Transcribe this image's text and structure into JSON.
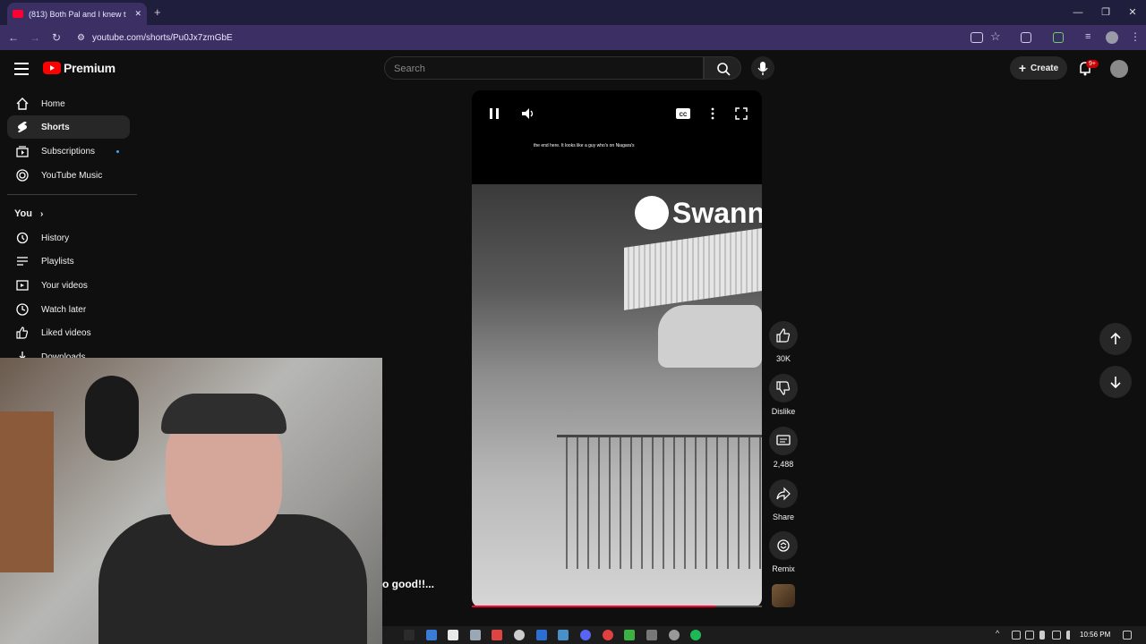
{
  "browser": {
    "tab_title": "(813) Both Pal and I knew t",
    "url": "youtube.com/shorts/Pu0Jx7zmGbE"
  },
  "header": {
    "logo_text": "Premium",
    "search_placeholder": "Search",
    "create_label": "Create",
    "notification_count": "9+"
  },
  "sidebar": {
    "items": [
      {
        "label": "Home",
        "icon": "home-icon"
      },
      {
        "label": "Shorts",
        "icon": "shorts-icon",
        "active": true
      },
      {
        "label": "Subscriptions",
        "icon": "subscriptions-icon"
      },
      {
        "label": "YouTube Music",
        "icon": "music-icon"
      }
    ],
    "you_label": "You",
    "you_items": [
      {
        "label": "History",
        "icon": "history-icon"
      },
      {
        "label": "Playlists",
        "icon": "playlists-icon"
      },
      {
        "label": "Your videos",
        "icon": "your-videos-icon"
      },
      {
        "label": "Watch later",
        "icon": "watch-later-icon"
      },
      {
        "label": "Liked videos",
        "icon": "liked-videos-icon"
      },
      {
        "label": "Downloads",
        "icon": "downloads-icon"
      }
    ]
  },
  "video": {
    "caption": "the end here. It looks like a guy who's on Niagara's",
    "watermark": "Swann",
    "progress": 0.84
  },
  "actions": {
    "like_count": "30K",
    "dislike_label": "Dislike",
    "comment_count": "2,488",
    "share_label": "Share",
    "remix_label": "Remix"
  },
  "overlay_text": "o good!!...",
  "taskbar": {
    "time": "10:56 PM"
  },
  "colors": {
    "accent": "#ff0033",
    "background": "#0f0f0f",
    "browser_toolbar": "#3b2f63"
  }
}
